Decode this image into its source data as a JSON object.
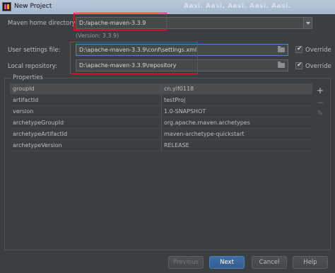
{
  "window": {
    "title": "New Project",
    "background_ghost_text": "Aasi. Aasi. Aasi. Aasi. Aasi."
  },
  "maven_home": {
    "label": "Maven home directory:",
    "value": "D:/apache-maven-3.3.9",
    "version_note": "(Version: 3.3.9)"
  },
  "user_settings": {
    "label": "User settings file:",
    "value": "D:\\apache-maven-3.3.9\\conf\\settings.xml",
    "override_label": "Override",
    "override_checked": true
  },
  "local_repo": {
    "label": "Local repository:",
    "value": "D:\\apache-maven-3.3.9\\repository",
    "override_label": "Override",
    "override_checked": true
  },
  "properties": {
    "section_title": "Properties",
    "rows": [
      {
        "key": "groupId",
        "value": "cn.yif0118"
      },
      {
        "key": "artifactId",
        "value": "testProj"
      },
      {
        "key": "version",
        "value": "1.0-SNAPSHOT"
      },
      {
        "key": "archetypeGroupId",
        "value": "org.apache.maven.archetypes"
      },
      {
        "key": "archetypeArtifactId",
        "value": "maven-archetype-quickstart"
      },
      {
        "key": "archetypeVersion",
        "value": "RELEASE"
      }
    ],
    "add_symbol": "+",
    "remove_symbol": "−",
    "edit_symbol": "✎"
  },
  "buttons": {
    "previous": "Previous",
    "next": "Next",
    "cancel": "Cancel",
    "help": "Help"
  },
  "colors": {
    "background": "#3c3f41",
    "field": "#45494a",
    "focus_border": "#4a88c7",
    "annotation_red": "#e02020",
    "primary_button": "#3e6da6"
  }
}
